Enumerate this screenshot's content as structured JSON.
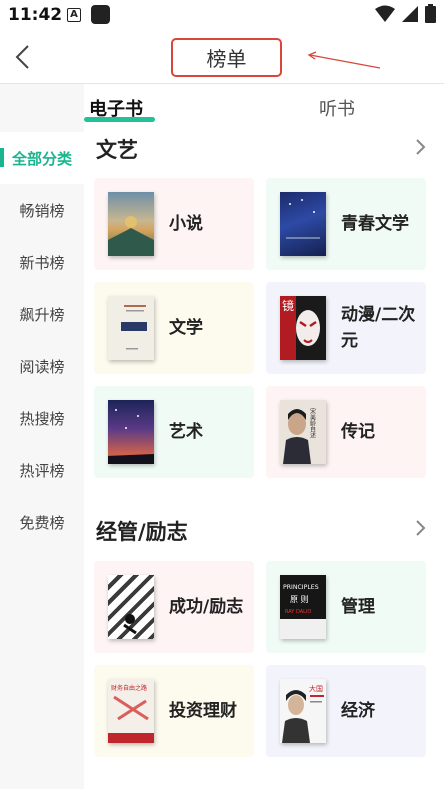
{
  "status_bar": {
    "time": "11:42",
    "a_badge": "A"
  },
  "header": {
    "title": "榜单"
  },
  "tabs": [
    {
      "label": "电子书",
      "active": true
    },
    {
      "label": "听书",
      "active": false
    }
  ],
  "sidebar": {
    "items": [
      {
        "label": "全部分类",
        "active": true
      },
      {
        "label": "畅销榜"
      },
      {
        "label": "新书榜"
      },
      {
        "label": "飙升榜"
      },
      {
        "label": "阅读榜"
      },
      {
        "label": "热搜榜"
      },
      {
        "label": "热评榜"
      },
      {
        "label": "免费榜"
      }
    ]
  },
  "sections": [
    {
      "title": "文艺",
      "categories": [
        {
          "label": "小说"
        },
        {
          "label": "青春文学"
        },
        {
          "label": "文学"
        },
        {
          "label": "动漫/二次元"
        },
        {
          "label": "艺术"
        },
        {
          "label": "传记"
        }
      ]
    },
    {
      "title": "经管/励志",
      "categories": [
        {
          "label": "成功/励志"
        },
        {
          "label": "管理"
        },
        {
          "label": "投资理财"
        },
        {
          "label": "经济"
        }
      ]
    }
  ],
  "cover_text": {
    "manage_en": "PRINCIPLES",
    "manage_cn": "原 则",
    "manage_author": "RAY DALIO",
    "invest": "财务自由之路",
    "bio": "宋美龄自述",
    "econ": "大国"
  },
  "colors": {
    "accent": "#19b58f",
    "tab_underline": "#22c19a",
    "annotation_red": "#d9463a"
  }
}
